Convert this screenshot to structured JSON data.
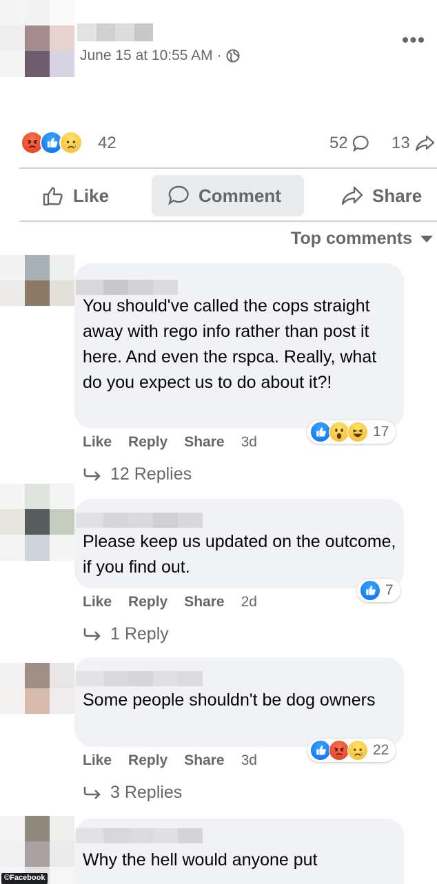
{
  "post": {
    "time": "June 15 at 10:55 AM",
    "separator": "·",
    "more": "•••"
  },
  "reactions": {
    "total": "42",
    "comments": "52",
    "shares": "13"
  },
  "actions": {
    "like": "Like",
    "comment": "Comment",
    "share": "Share"
  },
  "sort": {
    "label": "Top comments"
  },
  "comments": [
    {
      "text": "You should've called the cops straight away with rego info rather than post it here. And even the rspca. Really, what do you expect us to do about it?!",
      "reaction_count": "17",
      "like": "Like",
      "reply": "Reply",
      "share": "Share",
      "time": "3d",
      "replies": "12 Replies"
    },
    {
      "text": "Please keep us updated on the outcome, if you find out.",
      "reaction_count": "7",
      "like": "Like",
      "reply": "Reply",
      "share": "Share",
      "time": "2d",
      "replies": "1 Reply"
    },
    {
      "text": "Some people shouldn't be dog owners",
      "reaction_count": "22",
      "like": "Like",
      "reply": "Reply",
      "share": "Share",
      "time": "3d",
      "replies": "3 Replies"
    },
    {
      "text": "Why the hell would anyone put"
    }
  ],
  "source": "©Facebook"
}
